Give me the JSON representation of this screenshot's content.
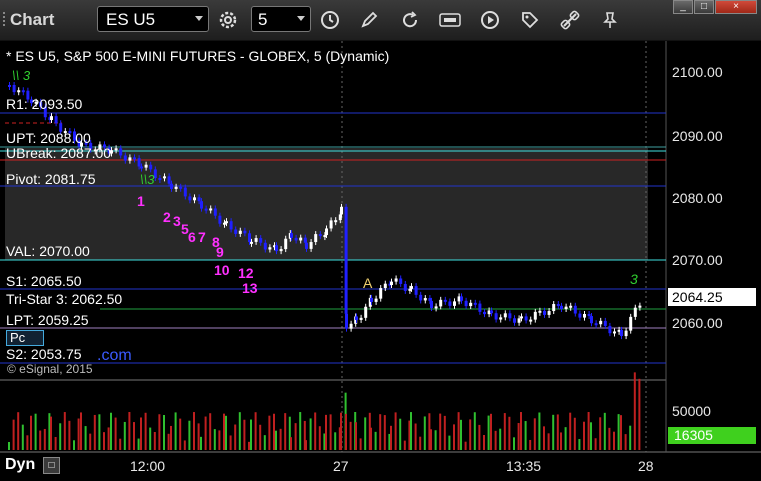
{
  "window": {
    "title": "Chart",
    "buttons": [
      "_",
      "□",
      "×"
    ]
  },
  "toolbar": {
    "symbol": "ES U5",
    "interval": "5",
    "icons": [
      "settings-gear-icon",
      "clock-icon",
      "pencil-icon",
      "refresh-icon",
      "get-quote-icon",
      "play-icon",
      "tag-icon",
      "link-icon",
      "pin-icon"
    ]
  },
  "chart": {
    "header": "* ES U5, S&P 500 E-MINI FUTURES - GLOBEX, 5 (Dynamic)",
    "copyright": "© eSignal, 2015",
    "com_text": ".com",
    "pc_label": "Pc",
    "mode_label": "Dyn",
    "current_price": "2064.25",
    "current_volume": "16305",
    "a_marker": "A",
    "price_axis": [
      "2100.00",
      "2090.00",
      "2080.00",
      "2070.00",
      "2060.00"
    ],
    "volume_axis": [
      "50000"
    ],
    "time_axis": [
      "12:00",
      "27",
      "13:35",
      "28"
    ],
    "levels": [
      {
        "label": "R1: 2093.50",
        "color": "#ffffff"
      },
      {
        "label": "UPT: 2088.00",
        "color": "#ffffff"
      },
      {
        "label": "UBreak: 2087.00",
        "color": "#ffffff"
      },
      {
        "label": "Pivot: 2081.75",
        "color": "#ffffff"
      },
      {
        "label": "VAL: 2070.00",
        "color": "#ffffff"
      },
      {
        "label": "S1: 2065.50",
        "color": "#ffffff"
      },
      {
        "label": "Tri-Star 3: 2062.50",
        "color": "#ffffff"
      },
      {
        "label": "LPT: 2059.25",
        "color": "#ffffff"
      },
      {
        "label": "S2: 2053.75",
        "color": "#ffffff"
      }
    ],
    "sequence_numbers": [
      "1",
      "2",
      "3",
      "5",
      "6",
      "7",
      "8",
      "9",
      "10",
      "12",
      "13"
    ],
    "colors": {
      "background": "#000000",
      "up_bar": "#ffffff",
      "down_bar": "#2020ff",
      "level_blue": "#2233cc",
      "level_cyan": "#40e0e0",
      "level_red": "#cc2222",
      "level_green": "#20a040",
      "sequence": "#ff30ff",
      "volume_highlight": "#3fd01e"
    }
  }
}
